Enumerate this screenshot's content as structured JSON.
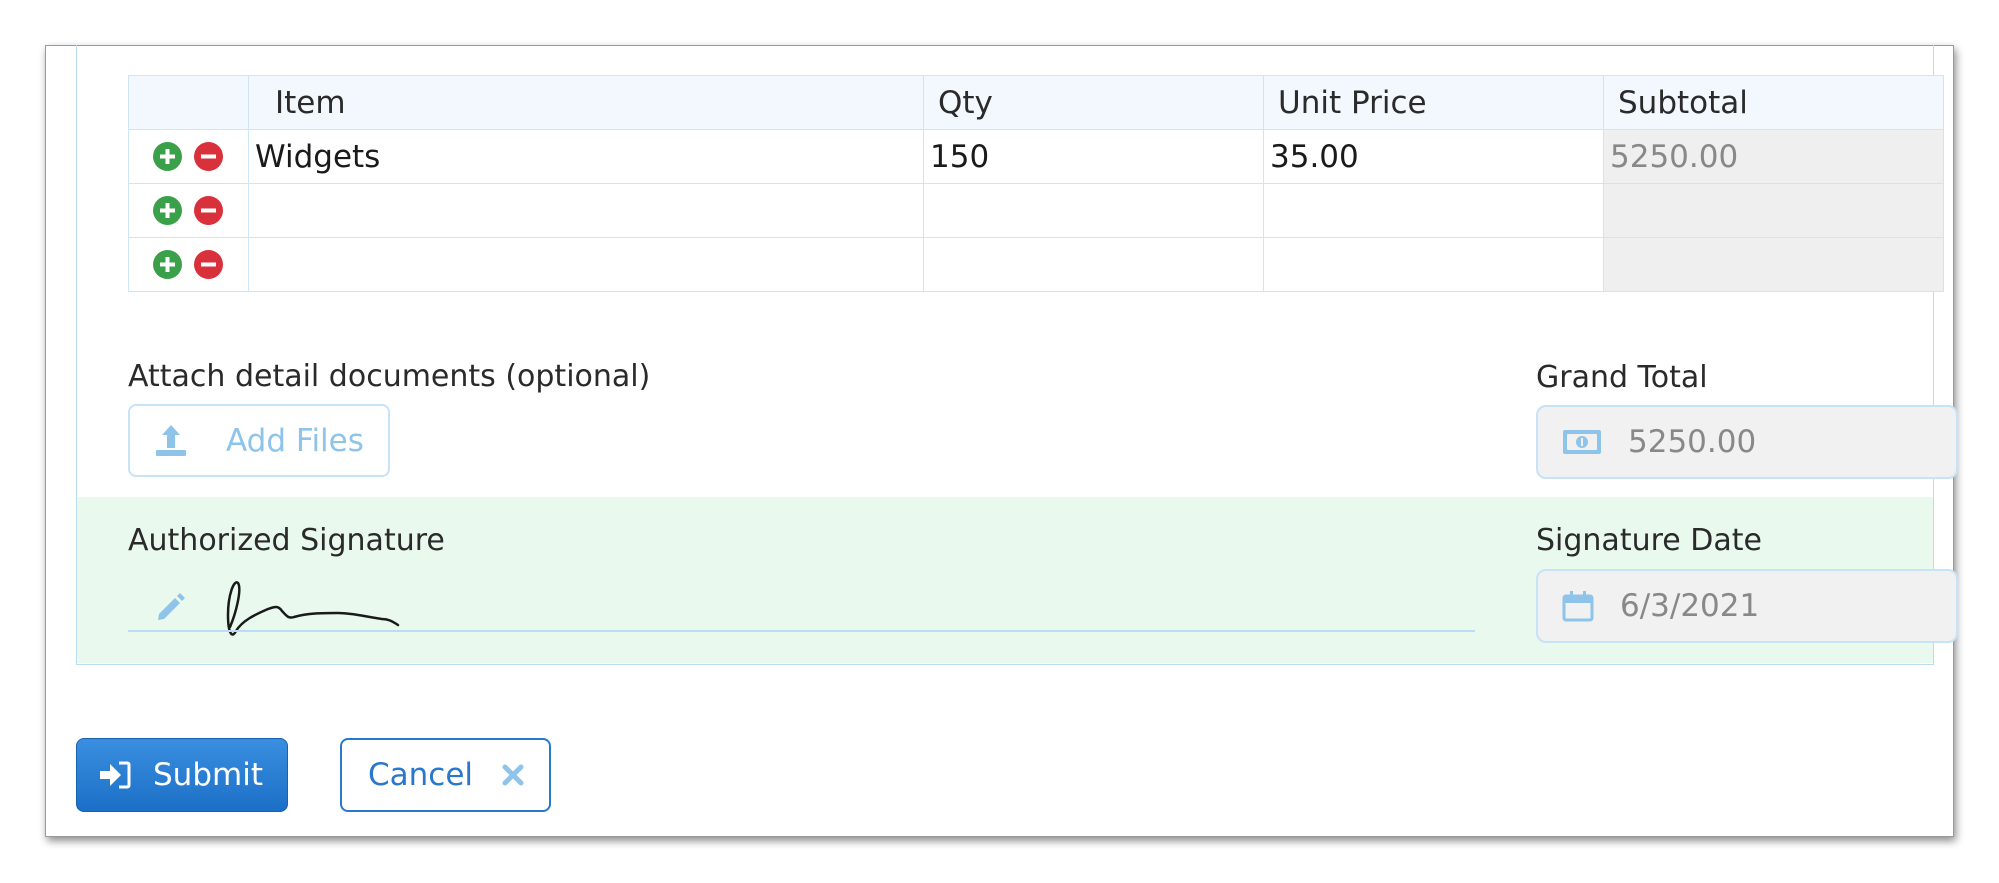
{
  "table": {
    "headers": [
      "",
      "Item",
      "Qty",
      "Unit Price",
      "Subtotal"
    ],
    "rows": [
      {
        "item": "Widgets",
        "qty": "150",
        "unit_price": "35.00",
        "subtotal": "5250.00"
      },
      {
        "item": "",
        "qty": "",
        "unit_price": "",
        "subtotal": ""
      },
      {
        "item": "",
        "qty": "",
        "unit_price": "",
        "subtotal": ""
      }
    ]
  },
  "attachments": {
    "label": "Attach detail documents (optional)",
    "button_label": "Add Files",
    "icon": "upload-icon"
  },
  "grand_total": {
    "label": "Grand Total",
    "value": "5250.00",
    "icon": "money-icon"
  },
  "signature": {
    "label": "Authorized Signature",
    "icon": "pencil-icon"
  },
  "signature_date": {
    "label": "Signature Date",
    "value": "6/3/2021",
    "icon": "calendar-icon"
  },
  "actions": {
    "submit_label": "Submit",
    "cancel_label": "Cancel"
  },
  "colors": {
    "accent": "#1b6fc6",
    "add": "#3aa04a",
    "remove": "#d9313b",
    "signature_band": "#eaf9ee",
    "field_border": "#c6e3f7"
  }
}
